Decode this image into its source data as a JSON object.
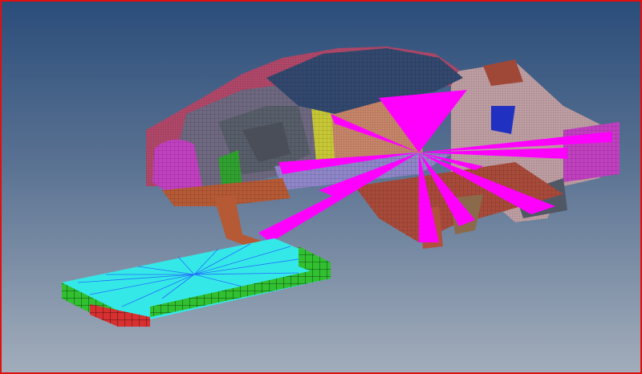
{
  "viewport": {
    "type": "fe-model-view",
    "background_top": "#2b4d7a",
    "background_bottom": "#a2adbb",
    "border_color": "#e01010"
  },
  "model": {
    "parts": [
      {
        "name": "roof-panel",
        "color": "#32486e"
      },
      {
        "name": "body-side-outer",
        "color": "#b2486a"
      },
      {
        "name": "rear-quarter",
        "color": "#6e6880"
      },
      {
        "name": "rear-wheelhouse",
        "color": "#c040c0"
      },
      {
        "name": "door-frame-inner",
        "color": "#585e6a"
      },
      {
        "name": "b-pillar",
        "color": "#c8c836"
      },
      {
        "name": "rocker-sill",
        "color": "#8e86c8"
      },
      {
        "name": "floor-rail",
        "color": "#a84a3a"
      },
      {
        "name": "front-structure",
        "color": "#c0a0a4"
      },
      {
        "name": "rigid-links",
        "color": "#ff00ff"
      }
    ]
  },
  "barrier": {
    "top_color": "#35e8e8",
    "side_green": "#30c030",
    "side_red": "#d83030",
    "ray_color": "#2060ff"
  }
}
